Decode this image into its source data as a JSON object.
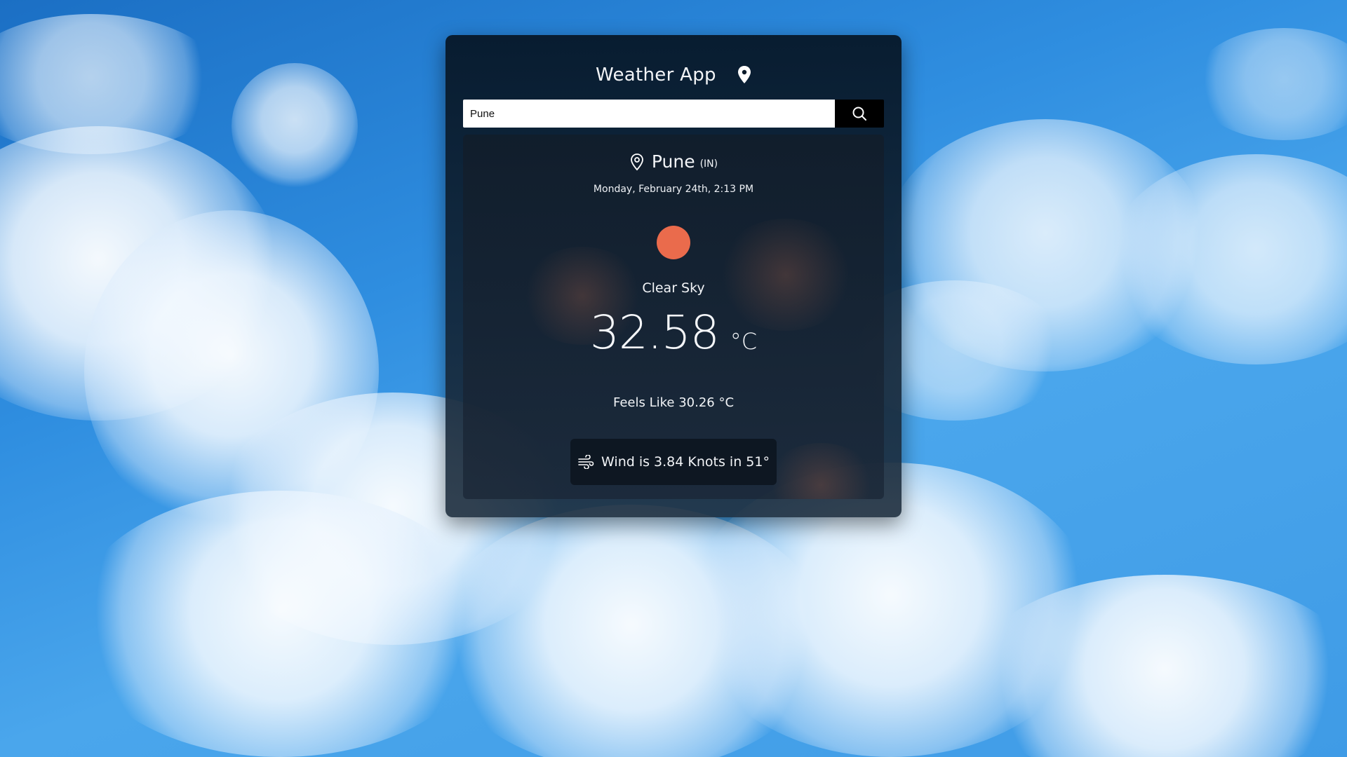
{
  "app": {
    "title": "Weather App"
  },
  "search": {
    "value": "Pune",
    "placeholder": ""
  },
  "location": {
    "city": "Pune",
    "country": "(IN)"
  },
  "datetime": "Monday, February 24th, 2:13 PM",
  "condition": "Clear Sky",
  "temperature": {
    "value": "32.58",
    "unit": "°C"
  },
  "feels_like": "Feels Like 30.26 °C",
  "wind": "Wind is 3.84 Knots in 51°",
  "icons": {
    "header": "map-pin-icon",
    "search": "search-icon",
    "location": "location-pin-icon",
    "weather": "sun-icon",
    "wind": "wind-icon"
  },
  "colors": {
    "sun": "#ea6b4c",
    "card_bg": "#0c1a28",
    "search_button": "#000000"
  }
}
